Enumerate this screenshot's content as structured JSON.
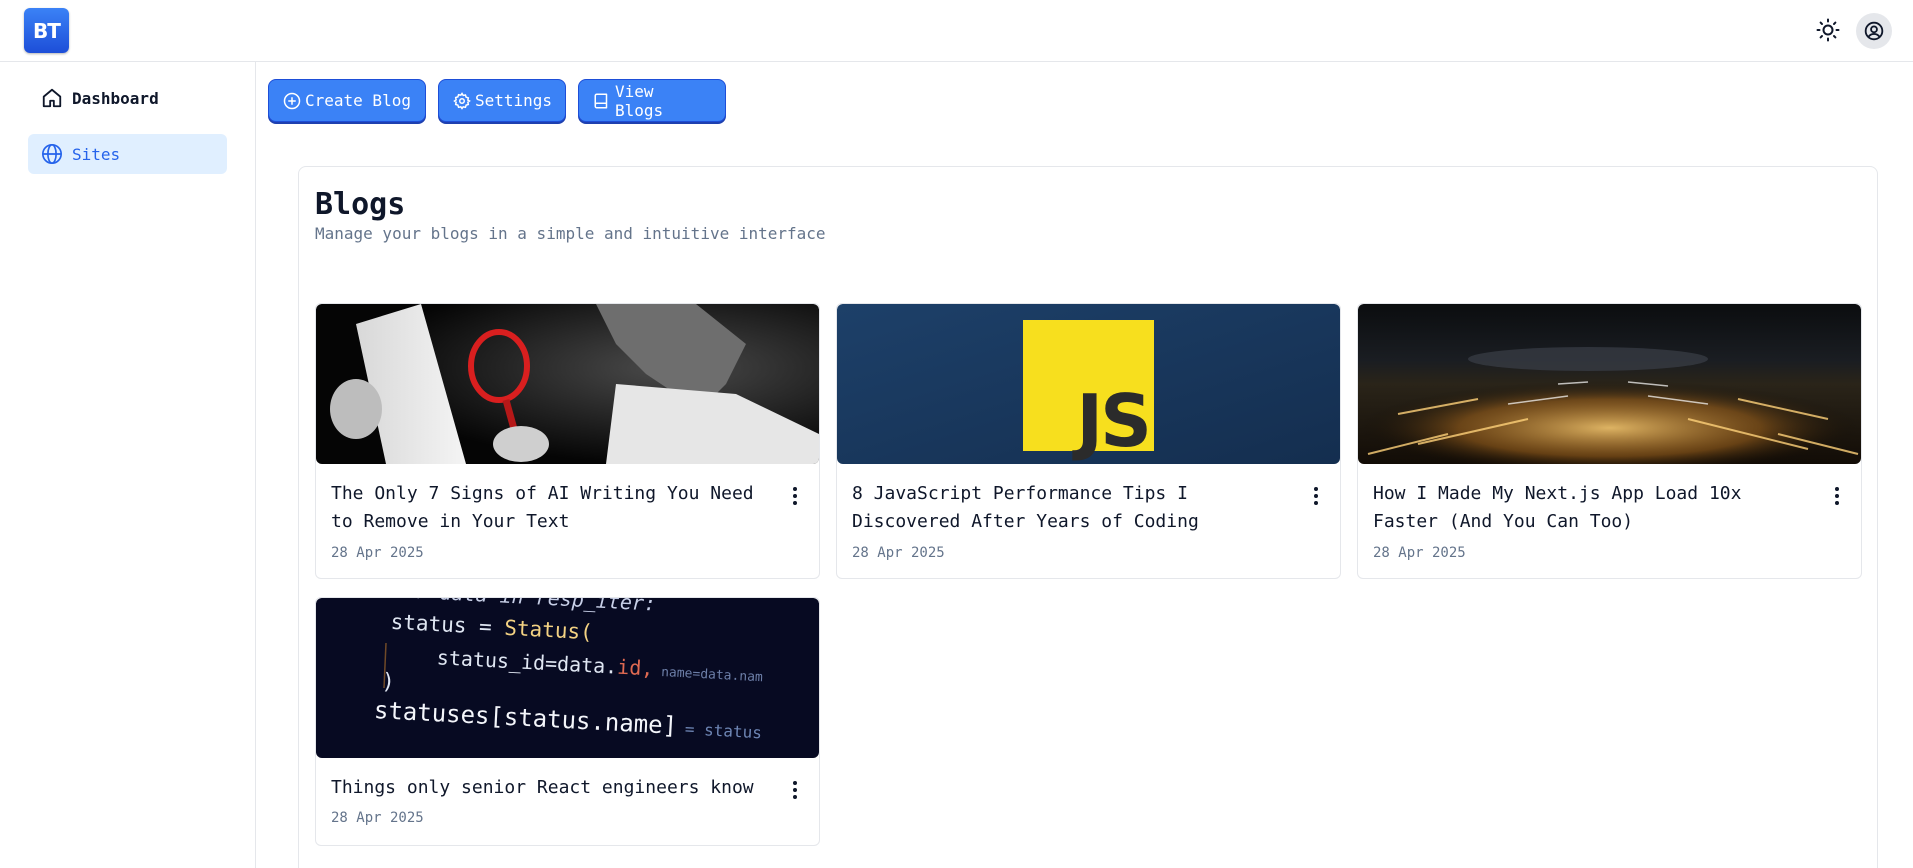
{
  "header": {
    "logo_text": "BT",
    "theme_icon": "sun-icon",
    "user_icon": "user-circle-icon"
  },
  "sidebar": {
    "items": [
      {
        "label": "Dashboard",
        "icon": "home-icon",
        "active": false
      },
      {
        "label": "Sites",
        "icon": "globe-icon",
        "active": true
      }
    ]
  },
  "toolbar": {
    "create_label": "Create Blog",
    "settings_label": "Settings",
    "view_label": "View Blogs"
  },
  "panel": {
    "title": "Blogs",
    "subtitle": "Manage your blogs in a simple and intuitive interface"
  },
  "blogs": [
    {
      "title": "The Only 7 Signs of AI Writing You Need to Remove in Your Text",
      "date": "28 Apr 2025",
      "image": "magnifying-glass-photo"
    },
    {
      "title": "8 JavaScript Performance Tips I Discovered After Years of Coding",
      "date": "28 Apr 2025",
      "image": "js-logo"
    },
    {
      "title": "How I Made My Next.js App Load 10x Faster (And You Can Too)",
      "date": "28 Apr 2025",
      "image": "city-lights-photo"
    },
    {
      "title": "Things only senior React engineers know",
      "date": "28 Apr 2025",
      "image": "code-screenshot"
    }
  ],
  "thumb_code": {
    "line1": "nc for data in resp_iter:",
    "line2_a": "status = ",
    "line2_b": "Status(",
    "line3_a": "status_id=data.",
    "line3_b": "id,",
    "line3_c": "name=data.nam",
    "line4": ")",
    "line5_a": "statuses[status.name]",
    "line5_b": "= status"
  },
  "thumb_js_text": "JS",
  "colors": {
    "accent": "#3b82f6",
    "accent_dark": "#1d4ed8",
    "active_bg": "#e0efff",
    "muted_text": "#64748b",
    "js_yellow": "#f7df1e",
    "js_bg": "#1b3a63"
  }
}
